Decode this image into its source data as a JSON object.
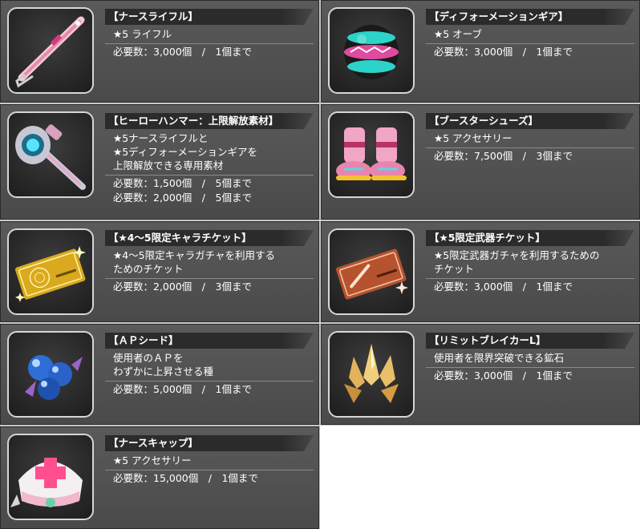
{
  "items": [
    {
      "title": "【ナースライフル】",
      "desc": [
        "★5 ライフル"
      ],
      "req": [
        "必要数：3,000個　/　1個まで"
      ],
      "icon": "nurse-rifle-icon"
    },
    {
      "title": "【ディフォーメーションギア】",
      "desc": [
        "★5 オーブ"
      ],
      "req": [
        "必要数：3,000個　/　1個まで"
      ],
      "icon": "deformation-gear-orb-icon"
    },
    {
      "title": "【ヒーローハンマー：上限解放素材】",
      "desc": [
        "★5ナースライフルと",
        "★5ディフォーメーションギアを",
        "上限解放できる専用素材"
      ],
      "req": [
        "必要数：1,500個　/　5個まで",
        "必要数：2,000個　/　5個まで"
      ],
      "icon": "hero-hammer-icon"
    },
    {
      "title": "【ブースターシューズ】",
      "desc": [
        "★5 アクセサリー"
      ],
      "req": [
        "必要数：7,500個　/　3個まで"
      ],
      "icon": "booster-shoes-icon"
    },
    {
      "title": "【★4～5限定キャラチケット】",
      "desc": [
        "★4～5限定キャラガチャを利用する",
        "ためのチケット"
      ],
      "req": [
        "必要数：2,000個　/　3個まで"
      ],
      "icon": "gold-ticket-icon"
    },
    {
      "title": "【★5限定武器チケット】",
      "desc": [
        "★5限定武器ガチャを利用するための",
        "チケット"
      ],
      "req": [
        "必要数：3,000個　/　1個まで"
      ],
      "icon": "copper-ticket-icon"
    },
    {
      "title": "【ＡＰシード】",
      "desc": [
        "使用者のＡＰを",
        "わずかに上昇させる種"
      ],
      "req": [
        "必要数：5,000個　/　1個まで"
      ],
      "icon": "ap-seed-icon"
    },
    {
      "title": "【リミットブレイカーL】",
      "desc": [
        "使用者を限界突破できる鉱石"
      ],
      "req": [
        "必要数：3,000個　/　1個まで"
      ],
      "icon": "limit-breaker-crystal-icon"
    },
    {
      "title": "【ナースキャップ】",
      "desc": [
        "★5 アクセサリー"
      ],
      "req": [
        "必要数：15,000個　/　1個まで"
      ],
      "icon": "nurse-cap-icon"
    }
  ],
  "colors": {
    "card_bg": "#4f4f4f",
    "title_bar": "#2b2b2b",
    "text": "#ffffff",
    "divider": "#8a8a8a"
  }
}
